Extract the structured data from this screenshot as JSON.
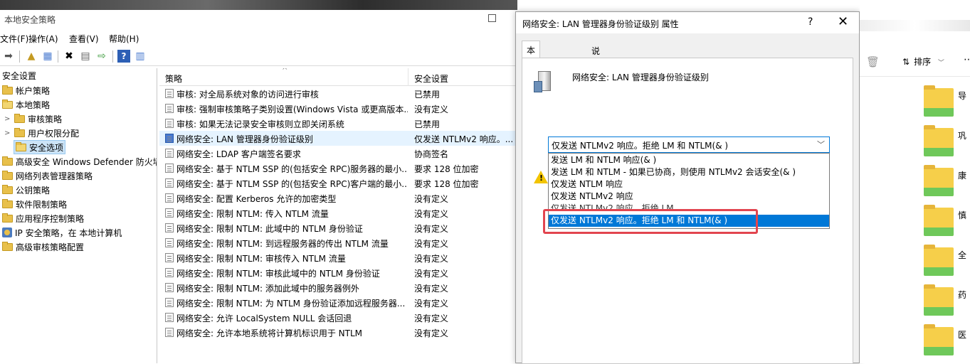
{
  "mmc": {
    "title": "本地安全策略",
    "menu": [
      "文件(F)",
      "操作(A)",
      "查看(V)",
      "帮助(H)"
    ],
    "tree": {
      "root": "安全设置",
      "items": [
        {
          "label": "帐户策略",
          "level": 1,
          "chevron": ""
        },
        {
          "label": "本地策略",
          "level": 1,
          "chevron": ""
        },
        {
          "label": "审核策略",
          "level": 2,
          "chevron": ">"
        },
        {
          "label": "用户权限分配",
          "level": 2,
          "chevron": ">"
        },
        {
          "label": "安全选项",
          "level": 2,
          "chevron": "",
          "selected": true
        },
        {
          "label": "高级安全 Windows Defender 防火墙",
          "level": 1,
          "chevron": ""
        },
        {
          "label": "网络列表管理器策略",
          "level": 1,
          "chevron": ""
        },
        {
          "label": "公钥策略",
          "level": 1,
          "chevron": ""
        },
        {
          "label": "软件限制策略",
          "level": 1,
          "chevron": ""
        },
        {
          "label": "应用程序控制策略",
          "level": 1,
          "chevron": ""
        },
        {
          "label": "IP 安全策略，在 本地计算机",
          "level": 1,
          "chevron": "",
          "icon": "ip"
        },
        {
          "label": "高级审核策略配置",
          "level": 1,
          "chevron": ""
        }
      ]
    },
    "list": {
      "col_policy": "策略",
      "col_setting": "安全设置",
      "rows": [
        {
          "name": "审核: 对全局系统对象的访问进行审核",
          "setting": "已禁用"
        },
        {
          "name": "审核: 强制审核策略子类别设置(Windows Vista 或更高版本...",
          "setting": "没有定义"
        },
        {
          "name": "审核: 如果无法记录安全审核则立即关闭系统",
          "setting": "已禁用"
        },
        {
          "name": "网络安全: LAN 管理器身份验证级别",
          "setting": "仅发送 NTLMv2 响应。...",
          "selected": true
        },
        {
          "name": "网络安全: LDAP 客户端签名要求",
          "setting": "协商签名"
        },
        {
          "name": "网络安全: 基于 NTLM SSP 的(包括安全 RPC)服务器的最小...",
          "setting": "要求 128 位加密"
        },
        {
          "name": "网络安全: 基于 NTLM SSP 的(包括安全 RPC)客户端的最小...",
          "setting": "要求 128 位加密"
        },
        {
          "name": "网络安全: 配置 Kerberos 允许的加密类型",
          "setting": "没有定义"
        },
        {
          "name": "网络安全: 限制 NTLM: 传入 NTLM 流量",
          "setting": "没有定义"
        },
        {
          "name": "网络安全: 限制 NTLM: 此域中的 NTLM 身份验证",
          "setting": "没有定义"
        },
        {
          "name": "网络安全: 限制 NTLM: 到远程服务器的传出 NTLM 流量",
          "setting": "没有定义"
        },
        {
          "name": "网络安全: 限制 NTLM: 审核传入 NTLM 流量",
          "setting": "没有定义"
        },
        {
          "name": "网络安全: 限制 NTLM: 审核此域中的 NTLM 身份验证",
          "setting": "没有定义"
        },
        {
          "name": "网络安全: 限制 NTLM: 添加此域中的服务器例外",
          "setting": "没有定义"
        },
        {
          "name": "网络安全: 限制 NTLM: 为 NTLM 身份验证添加远程服务器...",
          "setting": "没有定义"
        },
        {
          "name": "网络安全: 允许 LocalSystem NULL 会话回退",
          "setting": "没有定义"
        },
        {
          "name": "网络安全: 允许本地系统将计算机标识用于 NTLM",
          "setting": "没有定义"
        }
      ]
    }
  },
  "dialog": {
    "title": "网络安全: LAN 管理器身份验证级别 属性",
    "help": "?",
    "close": "✕",
    "tabs": [
      "本地安全设置",
      "说明"
    ],
    "policy_title": "网络安全: LAN 管理器身份验证级别",
    "combo_value": "仅发送 NTLMv2 响应。拒绝 LM 和 NTLM(& )",
    "options": [
      "发送 LM 和 NTLM 响应(& )",
      "发送 LM 和 NTLM - 如果已协商，则使用 NTLMv2 会话安全(& )",
      "仅发送 NTLM 响应",
      "仅发送 NTLMv2 响应",
      "仅发送 NTLMv2 响应。拒绝 LM",
      "仅发送 NTLMv2 响应。拒绝 LM 和 NTLM(& )"
    ],
    "highlighted_option": 5
  },
  "explorer": {
    "sort_label": "排序",
    "folders": [
      "导",
      "巩",
      "康",
      "慎",
      "全",
      "药",
      "医"
    ]
  },
  "colors": {
    "accent": "#0078d7",
    "highlight_border": "#e2454f",
    "folder": "#f6cf4a"
  }
}
